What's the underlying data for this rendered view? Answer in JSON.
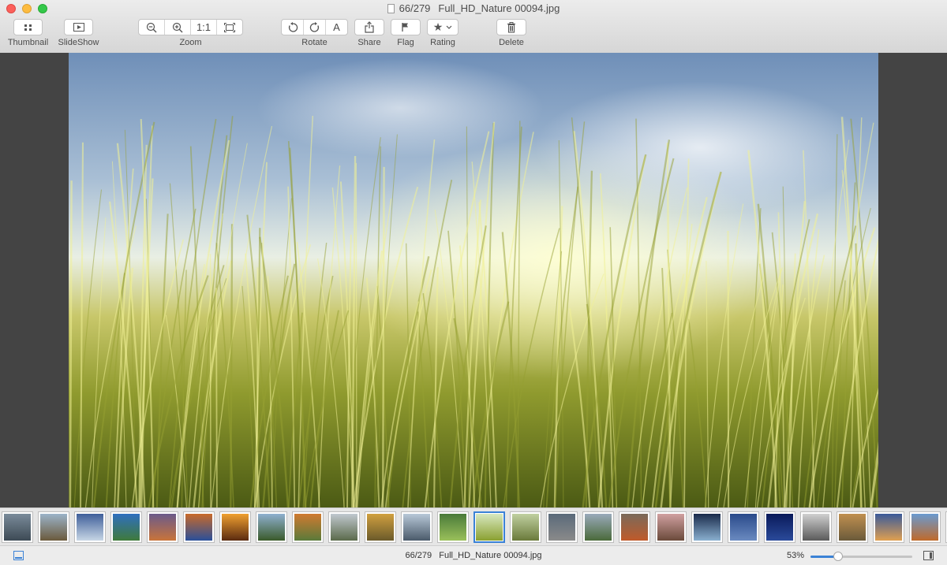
{
  "window": {
    "title_counter": "66/279",
    "title_filename": "Full_HD_Nature 00094.jpg"
  },
  "toolbar": {
    "thumbnail_label": "Thumbnail",
    "slideshow_label": "SlideShow",
    "zoom_label": "Zoom",
    "zoom_actual_size": "1:1",
    "rotate_label": "Rotate",
    "rotate_auto": "A",
    "share_label": "Share",
    "flag_label": "Flag",
    "rating_label": "Rating",
    "rating_star": "★",
    "delete_label": "Delete"
  },
  "viewer": {
    "image_name": "photo-grass-field"
  },
  "filmstrip": {
    "selected_index": 13,
    "thumbs": [
      {
        "top": "#7a8b9a",
        "bottom": "#3d4a55"
      },
      {
        "top": "#9bb3c9",
        "bottom": "#6b5a3c"
      },
      {
        "top": "#3f5f9a",
        "bottom": "#c7d6e5"
      },
      {
        "top": "#2f6fbf",
        "bottom": "#3f7a3a"
      },
      {
        "top": "#6b5a8a",
        "bottom": "#c9743a"
      },
      {
        "top": "#c96a2a",
        "bottom": "#2a4f9a"
      },
      {
        "top": "#f0a030",
        "bottom": "#5a2a10"
      },
      {
        "top": "#8fb0d0",
        "bottom": "#3a5a2a"
      },
      {
        "top": "#d07a30",
        "bottom": "#5a7a3a"
      },
      {
        "top": "#c0c8d0",
        "bottom": "#5a6a4a"
      },
      {
        "top": "#d0a040",
        "bottom": "#6a5a2a"
      },
      {
        "top": "#b8c8d8",
        "bottom": "#4a5a6a"
      },
      {
        "top": "#4a7a3a",
        "bottom": "#9ac05a"
      },
      {
        "top": "#d8e8c0",
        "bottom": "#8aa030"
      },
      {
        "top": "#c0d0a0",
        "bottom": "#6a7a3a"
      },
      {
        "top": "#5a6a7a",
        "bottom": "#8a8a8a"
      },
      {
        "top": "#9aaabb",
        "bottom": "#4a6a3a"
      },
      {
        "top": "#7a6a5a",
        "bottom": "#c05a2a"
      },
      {
        "top": "#d0a0a0",
        "bottom": "#6a4a3a"
      },
      {
        "top": "#1a2a4a",
        "bottom": "#8ab0d0"
      },
      {
        "top": "#2a4a8a",
        "bottom": "#6a8ac0"
      },
      {
        "top": "#0a1a5a",
        "bottom": "#2a4a9a"
      },
      {
        "top": "#d0d0d0",
        "bottom": "#5a5a5a"
      },
      {
        "top": "#c09050",
        "bottom": "#6a5a3a"
      },
      {
        "top": "#3a5a9a",
        "bottom": "#e0a050"
      },
      {
        "top": "#6a9ad0",
        "bottom": "#c06a2a"
      },
      {
        "top": "#8a9aaa",
        "bottom": "#4a5a6a"
      }
    ]
  },
  "status": {
    "counter": "66/279",
    "filename": "Full_HD_Nature 00094.jpg",
    "zoom_percent": "53%",
    "zoom_level": 0.27
  }
}
